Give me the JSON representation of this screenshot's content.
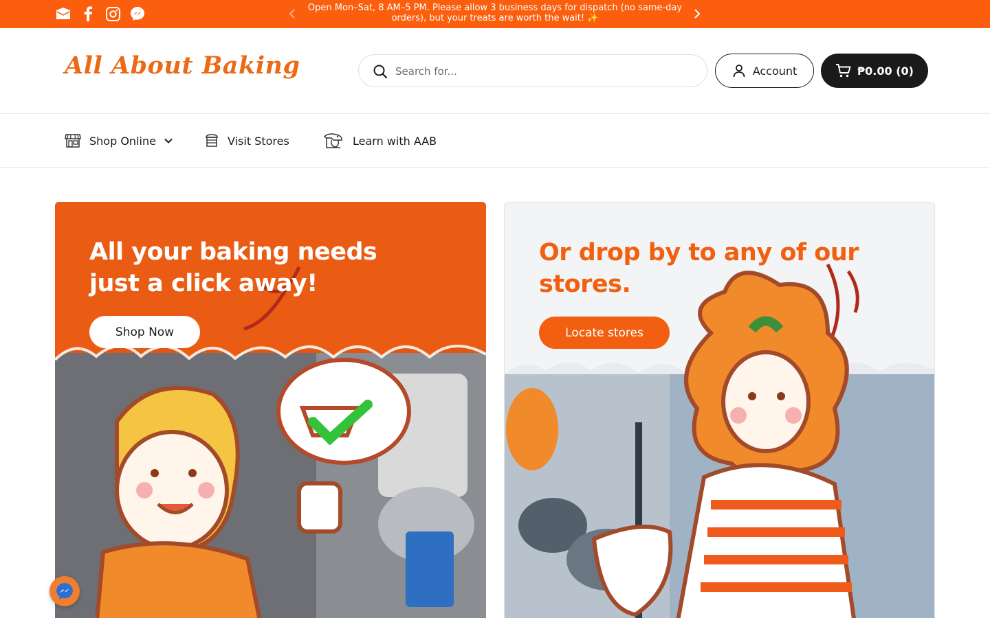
{
  "announcement": {
    "text": "Open Mon–Sat, 8 AM–5 PM. Please allow 3 business days for dispatch (no same-day orders), but your treats are worth the wait! ✨",
    "social_icons": [
      "mail-icon",
      "facebook-icon",
      "instagram-icon",
      "messenger-icon"
    ]
  },
  "header": {
    "logo": "All About Baking",
    "search_placeholder": "Search for...",
    "account_label": "Account",
    "cart_label": "₱0.00 (0)"
  },
  "nav": {
    "items": [
      {
        "label": "Shop Online",
        "icon": "storefront-icon"
      },
      {
        "label": "Visit Stores",
        "icon": "store-icon"
      },
      {
        "label": "Learn with AAB",
        "icon": "mixer-icon"
      }
    ]
  },
  "banners": {
    "left": {
      "title": "All your baking needs just a click away!",
      "button": "Shop Now"
    },
    "right": {
      "title": "Or drop by to any of our stores.",
      "button": "Locate stores"
    }
  },
  "colors": {
    "brand_orange": "#fb5f0e",
    "dark": "#1a1a1a"
  }
}
